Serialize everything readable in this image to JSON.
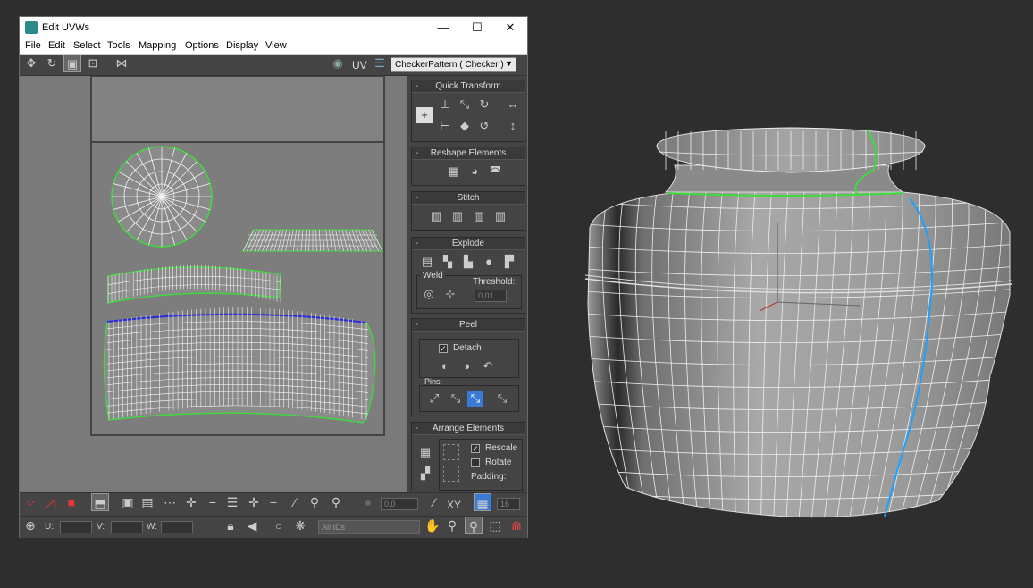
{
  "window": {
    "title": "Edit UVWs",
    "controls": {
      "minimize": "—",
      "maximize": "☐",
      "close": "✕"
    }
  },
  "menu": [
    "File",
    "Edit",
    "Select",
    "Tools",
    "Mapping",
    "Options",
    "Display",
    "View"
  ],
  "toolbar": {
    "uv_label": "UV",
    "texture_dropdown": "CheckerPattern  ( Checker )"
  },
  "panels": {
    "quick_transform": "Quick Transform",
    "reshape_elements": "Reshape Elements",
    "stitch": "Stitch",
    "explode": "Explode",
    "weld": "Weld",
    "threshold_label": "Threshold:",
    "threshold_value": "0,01",
    "peel": "Peel",
    "detach": "Detach",
    "pins": "Pins:",
    "arrange_elements": "Arrange Elements",
    "rescale": "Rescale",
    "rotate": "Rotate",
    "padding": "Padding:"
  },
  "bottom": {
    "angle_value": "0,0",
    "xy_label": "XY",
    "grid_value": "16",
    "u_label": "U:",
    "v_label": "V:",
    "w_label": "W:",
    "ids_dropdown": "All IDs"
  },
  "colors": {
    "seam_green": "#3ddc3d",
    "seam_blue": "#1e90ff",
    "uv_canvas": "#7a7a7a",
    "viewport_bg": "#2e2e2e"
  }
}
